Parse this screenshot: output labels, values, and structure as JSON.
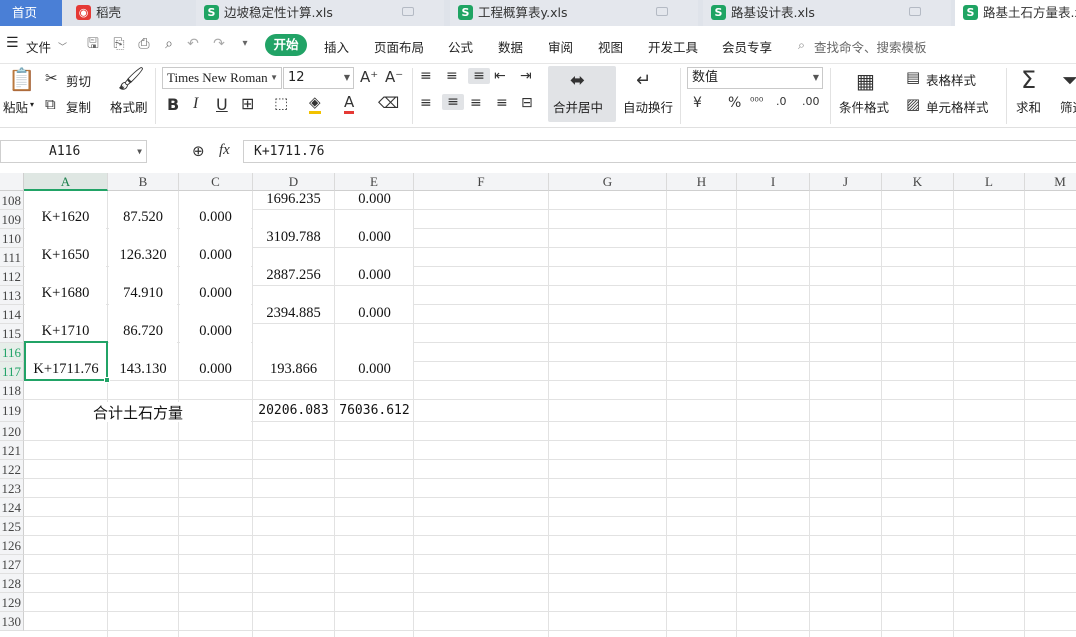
{
  "tabs": [
    {
      "label": "首页",
      "active": true
    },
    {
      "label": "稻壳",
      "icon": "docer-icon"
    },
    {
      "label": "边坡稳定性计算.xls",
      "icon": "sheet-icon"
    },
    {
      "label": "工程概算表y.xls",
      "icon": "sheet-icon"
    },
    {
      "label": "路基设计表.xls",
      "icon": "sheet-icon"
    },
    {
      "label": "路基土石方量表.x",
      "icon": "sheet-icon"
    }
  ],
  "menu": {
    "file": "文件",
    "items": [
      "开始",
      "插入",
      "页面布局",
      "公式",
      "数据",
      "审阅",
      "视图",
      "开发工具",
      "会员专享"
    ],
    "search": "查找命令、搜索模板"
  },
  "ribbon": {
    "paste": "粘贴",
    "cut": "剪切",
    "copy": "复制",
    "format_painter": "格式刷",
    "font_name": "Times New Roman",
    "font_size": "12",
    "merge_center": "合并居中",
    "wrap_text": "自动换行",
    "number_format": "数值",
    "cond_format": "条件格式",
    "table_style": "表格样式",
    "cell_style": "单元格样式",
    "sum": "求和",
    "filter": "筛选"
  },
  "formula_bar": {
    "name_box": "A116",
    "fx": "fx",
    "content": "K+1711.76"
  },
  "columns": [
    "A",
    "B",
    "C",
    "D",
    "E",
    "F",
    "G",
    "H",
    "I",
    "J",
    "K",
    "L",
    "M"
  ],
  "rows": [
    "108",
    "109",
    "110",
    "111",
    "112",
    "113",
    "114",
    "115",
    "116",
    "117",
    "118",
    "119",
    "120",
    "121",
    "122",
    "123",
    "124",
    "125",
    "126",
    "127",
    "128",
    "129",
    "130"
  ],
  "cells": {
    "a109": "K+1620",
    "b109": "87.520",
    "c109": "0.000",
    "a111": "K+1650",
    "b111": "126.320",
    "c111": "0.000",
    "a113": "K+1680",
    "b113": "74.910",
    "c113": "0.000",
    "a115": "K+1710",
    "b115": "86.720",
    "c115": "0.000",
    "a117": "K+1711.76",
    "b117": "143.130",
    "c117": "0.000",
    "d108": "1696.235",
    "e108": "0.000",
    "d110": "3109.788",
    "e110": "0.000",
    "d112": "2887.256",
    "e112": "0.000",
    "d114": "2394.885",
    "e114": "0.000",
    "d117": "193.866",
    "e117": "0.000",
    "total_label": "合计土石方量",
    "total_d": "20206.083",
    "total_e": "76036.612"
  },
  "colors": {
    "accent": "#21a366",
    "tabbar": "#dfe3ea"
  }
}
